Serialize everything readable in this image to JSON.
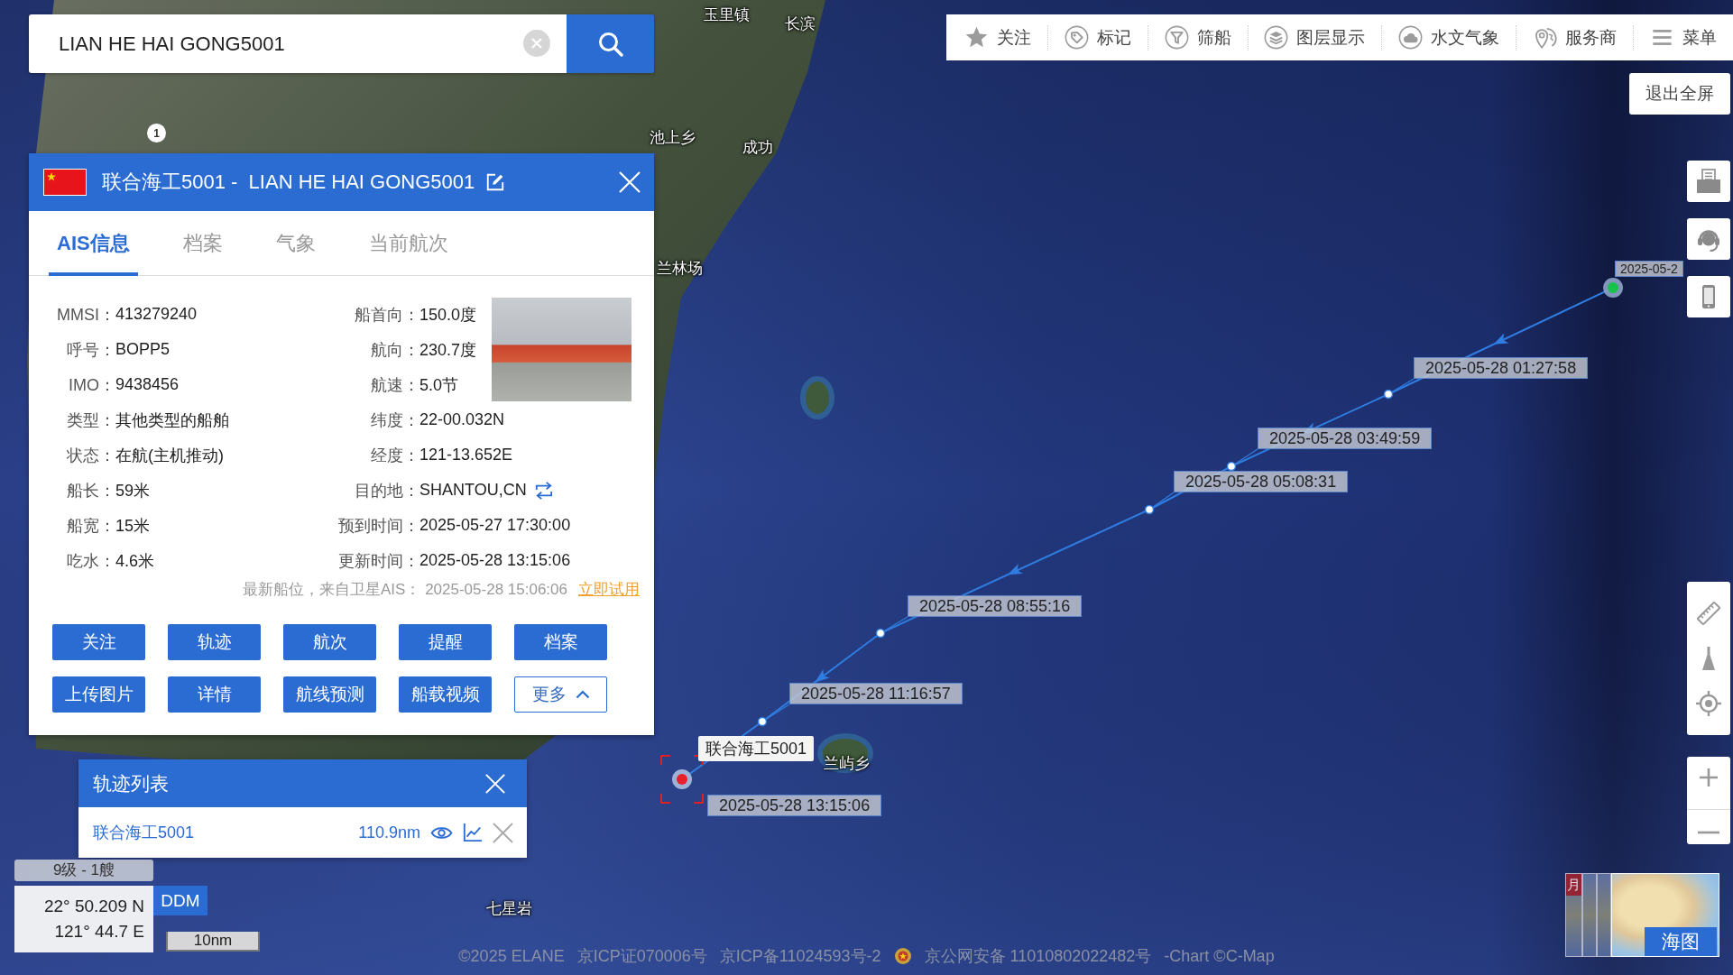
{
  "search": {
    "value": "LIAN HE HAI GONG5001"
  },
  "toolbar": [
    {
      "label": "关注"
    },
    {
      "label": "标记"
    },
    {
      "label": "筛船"
    },
    {
      "label": "图层显示"
    },
    {
      "label": "水文气象"
    },
    {
      "label": "服务商"
    },
    {
      "label": "菜单"
    }
  ],
  "exit_fullscreen": {
    "label": "退出全屏"
  },
  "ship_panel": {
    "title": "联合海工5001 -  LIAN HE HAI GONG5001",
    "tabs": [
      {
        "label": "AIS信息",
        "selected": true
      },
      {
        "label": "档案",
        "selected": false
      },
      {
        "label": "气象",
        "selected": false
      },
      {
        "label": "当前航次",
        "selected": false
      }
    ],
    "fields_left": [
      {
        "label": "MMSI：",
        "value": "413279240"
      },
      {
        "label": "呼号：",
        "value": "BOPP5"
      },
      {
        "label": "IMO：",
        "value": "9438456"
      },
      {
        "label": "类型：",
        "value": "其他类型的船舶"
      },
      {
        "label": "状态：",
        "value": "在航(主机推动)"
      },
      {
        "label": "船长：",
        "value": "59米"
      },
      {
        "label": "船宽：",
        "value": "15米"
      },
      {
        "label": "吃水：",
        "value": "4.6米"
      }
    ],
    "fields_right": [
      {
        "label": "船首向：",
        "value": "150.0度",
        "kind": "text"
      },
      {
        "label": "航向：",
        "value": "230.7度",
        "kind": "text"
      },
      {
        "label": "航速：",
        "value": "5.0节",
        "kind": "text"
      },
      {
        "label": "纬度：",
        "value": "22-00.032N",
        "kind": "text"
      },
      {
        "label": "经度：",
        "value": "121-13.652E",
        "kind": "text"
      },
      {
        "label": "目的地：",
        "value": "SHANTOU,CN",
        "kind": "port"
      },
      {
        "label": "预到时间：",
        "value": "2025-05-27 17:30:00",
        "kind": "text"
      },
      {
        "label": "更新时间：",
        "value": "2025-05-28 13:15:06",
        "kind": "text"
      }
    ],
    "position_note": {
      "text": "最新船位，来自卫星AIS： 2025-05-28 15:06:06",
      "link": "立即试用"
    },
    "buttons": [
      {
        "label": "关注",
        "kind": "filled"
      },
      {
        "label": "轨迹",
        "kind": "filled"
      },
      {
        "label": "航次",
        "kind": "filled"
      },
      {
        "label": "提醒",
        "kind": "filled"
      },
      {
        "label": "档案",
        "kind": "filled"
      },
      {
        "label": "上传图片",
        "kind": "filled"
      },
      {
        "label": "详情",
        "kind": "filled"
      },
      {
        "label": "航线预测",
        "kind": "filled"
      },
      {
        "label": "船载视频",
        "kind": "filled"
      },
      {
        "label": "更多",
        "kind": "dropdown"
      }
    ]
  },
  "track_list": {
    "title": "轨迹列表",
    "rows": [
      {
        "name": "联合海工5001",
        "distance": "110.9nm"
      }
    ]
  },
  "map": {
    "place_labels": [
      "玉里镇",
      "长滨",
      "池上乡",
      "成功",
      "兰林场",
      "兰屿乡",
      "七星岩"
    ],
    "road_marker": "1",
    "track": {
      "points": [
        {
          "time": "2025-05-2",
          "kind": "start"
        },
        {
          "time": "2025-05-28 01:27:58",
          "kind": "waypoint"
        },
        {
          "time": "2025-05-28 03:49:59",
          "kind": "waypoint"
        },
        {
          "time": "2025-05-28 05:08:31",
          "kind": "waypoint"
        },
        {
          "time": "2025-05-28 08:55:16",
          "kind": "waypoint"
        },
        {
          "time": "2025-05-28 11:16:57",
          "kind": "waypoint"
        }
      ],
      "ship": {
        "name": "联合海工5001",
        "time": "2025-05-28 13:15:06"
      }
    }
  },
  "map_status": {
    "ship_count": "9级 - 1艘",
    "latitude": "22° 50.209 N",
    "longitude": "121° 44.7 E",
    "format_button": "DDM",
    "scale": "10nm"
  },
  "layer_switcher": {
    "thumbnail_label": "月",
    "chart_label": "海图"
  },
  "footer": [
    "©2025 ELANE",
    "京ICP证070006号",
    "京ICP备11024593号-2",
    "京公网安备 11010802022482号",
    "-Chart ©C-Map"
  ]
}
